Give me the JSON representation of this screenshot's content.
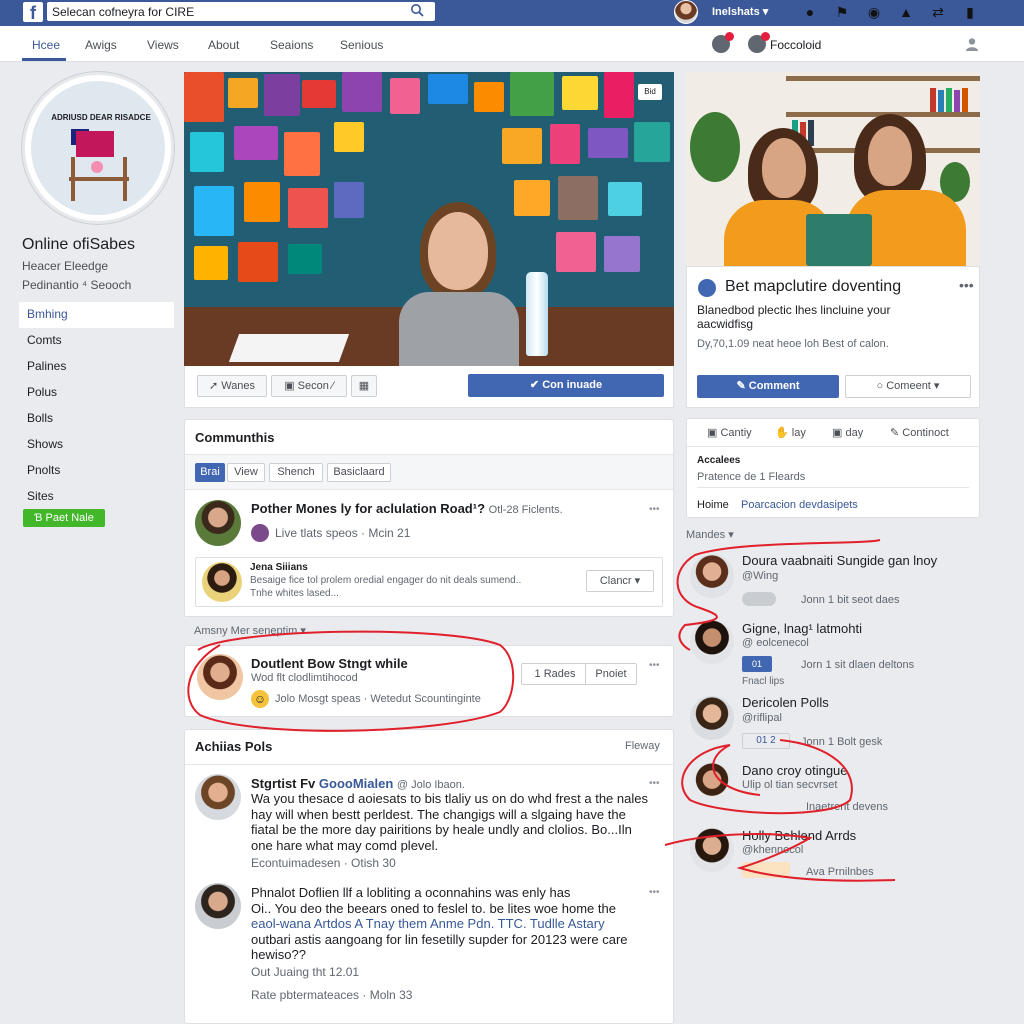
{
  "topbar": {
    "search_text": "Selecan cofneyra for CIRE",
    "user_name": "Inelshats ▾"
  },
  "nav": {
    "tabs": [
      "Hcee",
      "Awigs",
      "Views",
      "About",
      "Seaions",
      "Senious"
    ],
    "page_label": "Foccoloid"
  },
  "sidebar": {
    "profile_logo_text": "ADRIUSD DEAR RISADCE",
    "page_name": "Online ofiSabes",
    "sub1": "Heacer Eleedge",
    "sub2": "Pedinantio ⁴ Seooch",
    "items": [
      "Bmhing",
      "Comts",
      "Palines",
      "Polus",
      "Bolls",
      "Shows",
      "Pnolts",
      "Sites"
    ],
    "green_button": "Ɓ Paet Nale"
  },
  "hero": {
    "badge": "Bid",
    "actions": {
      "wanes": "Wanes",
      "secon": "Secon",
      "continue": "Con inuade"
    }
  },
  "profile_card": {
    "title": "Bet mapclutire doventing",
    "desc": "Blanedbod plectic lhes lincluine your aacwidfisg",
    "meta": "Dy,70,1.09 neat heoe loh Best of calon.",
    "comment_label": "Comment",
    "comment2_label": "Comeent ▾"
  },
  "side_actions": {
    "items": [
      "Cantiy",
      "lay",
      "day",
      "Continoct"
    ],
    "accolees_label": "Accalees",
    "accolees_value": "Pratence de 1 Fleards",
    "home_label": "Hoime",
    "home_link": "Poarcacion devdasipets"
  },
  "community": {
    "title": "Communthis",
    "tabs": [
      "Brai",
      "View",
      "Shench",
      "Basiclaard"
    ],
    "post1": {
      "title": "Pother Mones ly for aclulation Road¹?",
      "meta_right": "Otl-28 Ficlents.",
      "sub": "Live tlats speos · Mcin 21"
    },
    "reply": {
      "name": "Jena Siiians",
      "text": "Besaige fice tol prolem oredial engager do nit deals sumend..",
      "text2": "Tnhe whites lased...",
      "button": "Clancr ▾"
    },
    "section_label": "Amsny Mer seneptim ▾",
    "post2": {
      "title": "Doutlent Bow Stngt while",
      "sub": "Wod flt clodlimtihocod",
      "meta": "Jolo Mosgt speas · Wetedut Scountinginte",
      "btn1": "Rades",
      "btn2": "Pnoiet"
    }
  },
  "feed": {
    "title": "Achiias Pols",
    "right_label": "Fleway",
    "post1": {
      "name": "Stgrtist Fv ",
      "name_link": "GoooMialen",
      "handle": "@ Jolo Ibaon.",
      "lines": [
        "Wa you thesace d aoiesats to bis tlaliy us on do whd frest a the nales",
        "hay will when bestt perldest. The changigs will a slgaing have the",
        "fiatal be the more day pairitions by heale undly and clolios. Bo...Iln",
        "one hare what may comd plevel."
      ],
      "meta": "Econtuimadesen · Otish 30"
    },
    "post2": {
      "lines": [
        "Phnalot Doflien llf a lobliting a oconnahins was enly has",
        "Oi.. You deo the beears oned to feslel to. be lites woe home the",
        "eaol-wana Artdos A Tnay them Anme Pdn. TTC. Tudlle Astary",
        "outbari astis aangoang for lin fesetilly supder for 20123 were care",
        "hewiso??"
      ],
      "meta1": "Out Juaing tht 12.01",
      "meta2": "Rate pbtermateaces · Moln 33"
    }
  },
  "members": {
    "title": "Mandes ▾",
    "items": [
      {
        "name": "Doura vaabnaiti Sungide gan lnoy",
        "handle": "@Wing",
        "meta": "Jonn 1 bit seot daes"
      },
      {
        "name": "Gigne, lnag¹ latmohti",
        "handle": "@ eolcenecol",
        "meta": "Jorn 1 sit dlaen deltons",
        "sub": "Fnacl lips"
      },
      {
        "name": "Dericolen Polls",
        "handle": "@riflipal",
        "meta": "Jonn 1 Bolt gesk"
      },
      {
        "name": "Dano croy otingue",
        "handle": "Ulip ol tian secvrset",
        "meta": "Inaetrent devens"
      },
      {
        "name": "Holly Behlend Arrds",
        "handle": "@khennocol",
        "meta": "Ava Prnilnbes"
      }
    ]
  }
}
